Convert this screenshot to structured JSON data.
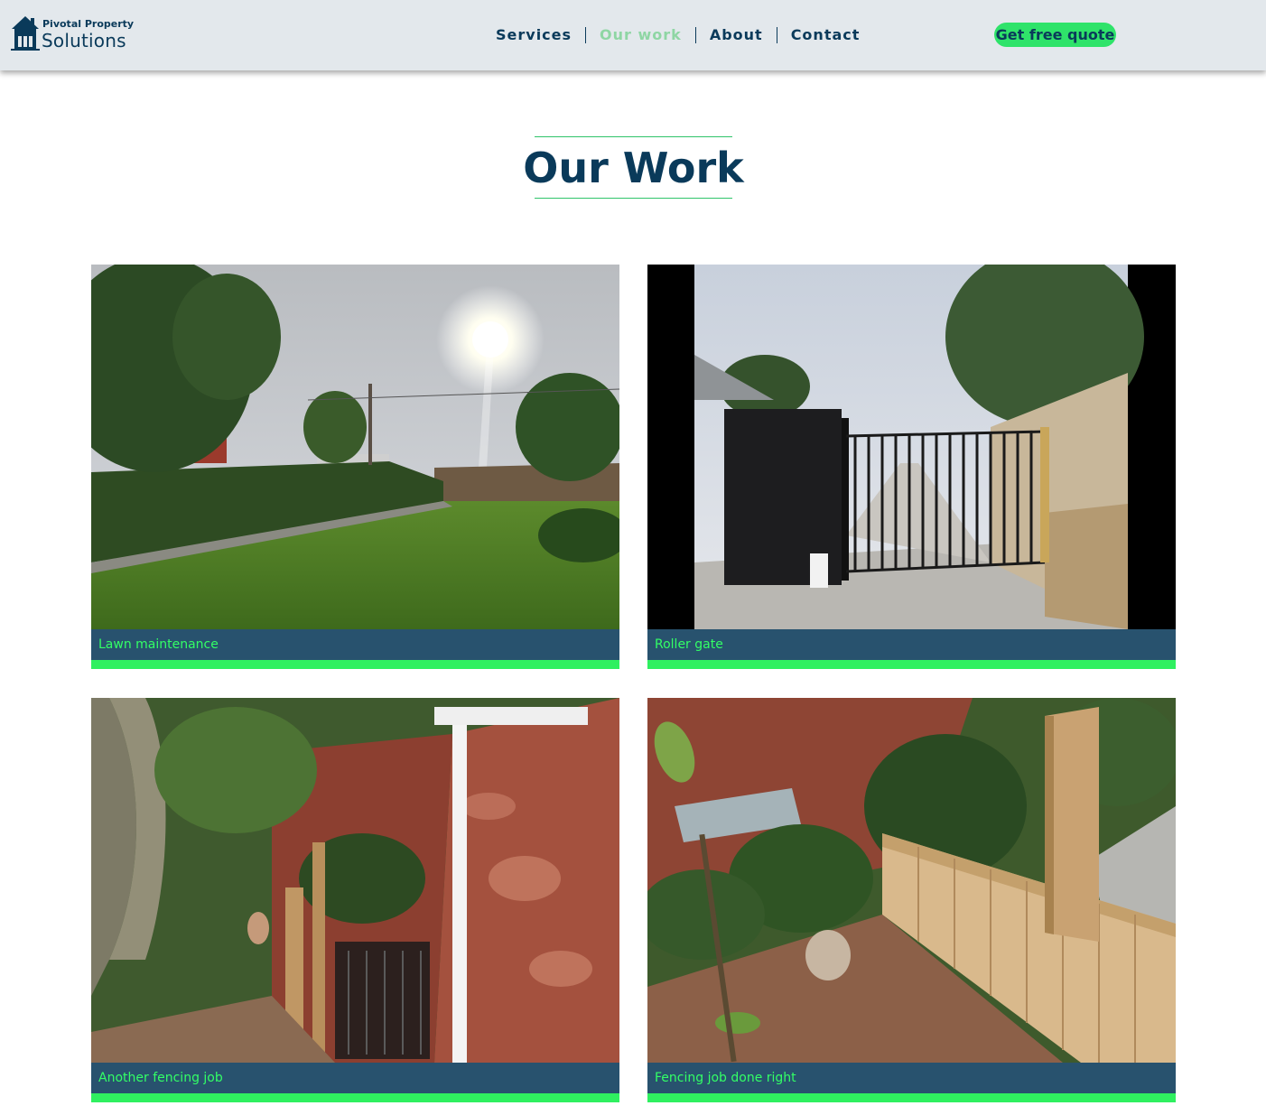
{
  "header": {
    "logo": {
      "small_text": "Pivotal Property",
      "big_text": "Solutions",
      "icon": "house-icon"
    },
    "nav": [
      {
        "label": "Services",
        "active": false
      },
      {
        "label": "Our work",
        "active": true
      },
      {
        "label": "About",
        "active": false
      },
      {
        "label": "Contact",
        "active": false
      }
    ],
    "cta_label": "Get free quote"
  },
  "page_title": "Our Work",
  "gallery": [
    {
      "caption": "Lawn maintenance",
      "image": "lawn-photo"
    },
    {
      "caption": "Roller gate",
      "image": "gate-photo"
    },
    {
      "caption": "Another fencing job",
      "image": "fence-photo-1"
    },
    {
      "caption": "Fencing job done right",
      "image": "fence-photo-2"
    }
  ],
  "colors": {
    "navy": "#0a3a5a",
    "accent_green": "#2fe36a",
    "active_nav": "#8fd6a4",
    "header_bg": "#e3e8ec"
  }
}
